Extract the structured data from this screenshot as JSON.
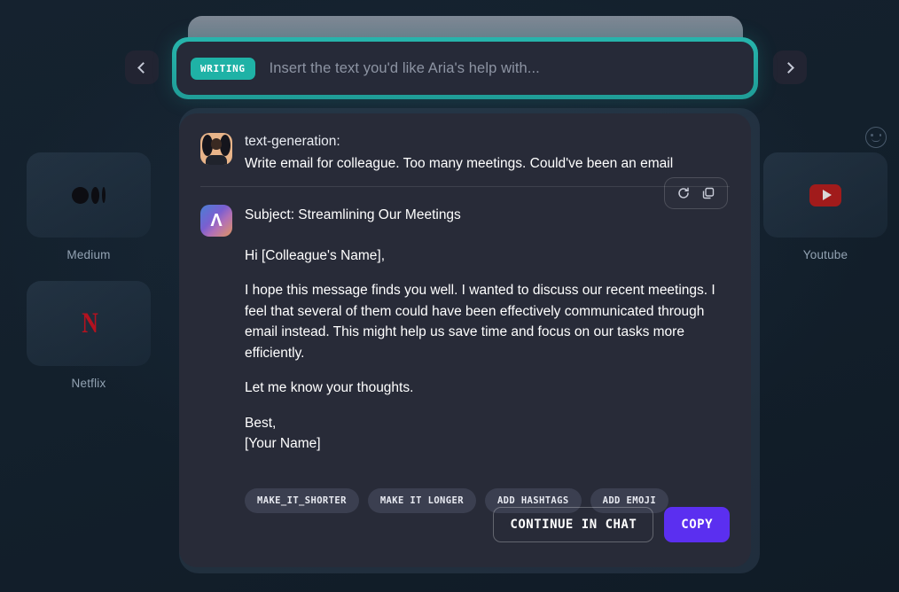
{
  "search": {
    "badge": "WRITING",
    "placeholder": "Insert the text you'd like Aria's help with...",
    "value": ""
  },
  "nav": {
    "prev_label": "Previous",
    "next_label": "Next"
  },
  "shortcuts_left": [
    {
      "name": "Medium",
      "icon": "medium-icon"
    },
    {
      "name": "Netflix",
      "icon": "netflix-icon"
    }
  ],
  "shortcuts_right": [
    {
      "name": "Youtube",
      "icon": "youtube-icon"
    }
  ],
  "card": {
    "prompt": {
      "title": "text-generation:",
      "query": "Write email for colleague. Too many meetings. Could've been an email"
    },
    "actions": {
      "regenerate": "regenerate-icon",
      "copy": "copy-icon"
    },
    "answer": {
      "subject": "Subject: Streamlining Our Meetings",
      "greeting": "Hi [Colleague's Name],",
      "body": "I hope this message finds you well. I wanted to discuss our recent meetings. I feel that several of them could have been effectively communicated through email instead. This might help us save time and focus on our tasks more efficiently.",
      "closing_question": "Let me know your thoughts.",
      "signoff": "Best,",
      "signature": "[Your Name]"
    },
    "suggestions": [
      "MAKE_IT_SHORTER",
      "MAKE IT LONGER",
      "ADD HASHTAGS",
      "ADD EMOJI"
    ],
    "footer": {
      "continue_label": "CONTINUE IN CHAT",
      "copy_label": "COPY"
    }
  },
  "feedback": {
    "icon": "smiley-icon"
  },
  "colors": {
    "accent_teal": "#1fb2a6",
    "accent_purple": "#5b2ff0",
    "background": "#142030",
    "card": "#282b38",
    "netflix_red": "#b4121f",
    "youtube_red": "#a11b1b"
  }
}
